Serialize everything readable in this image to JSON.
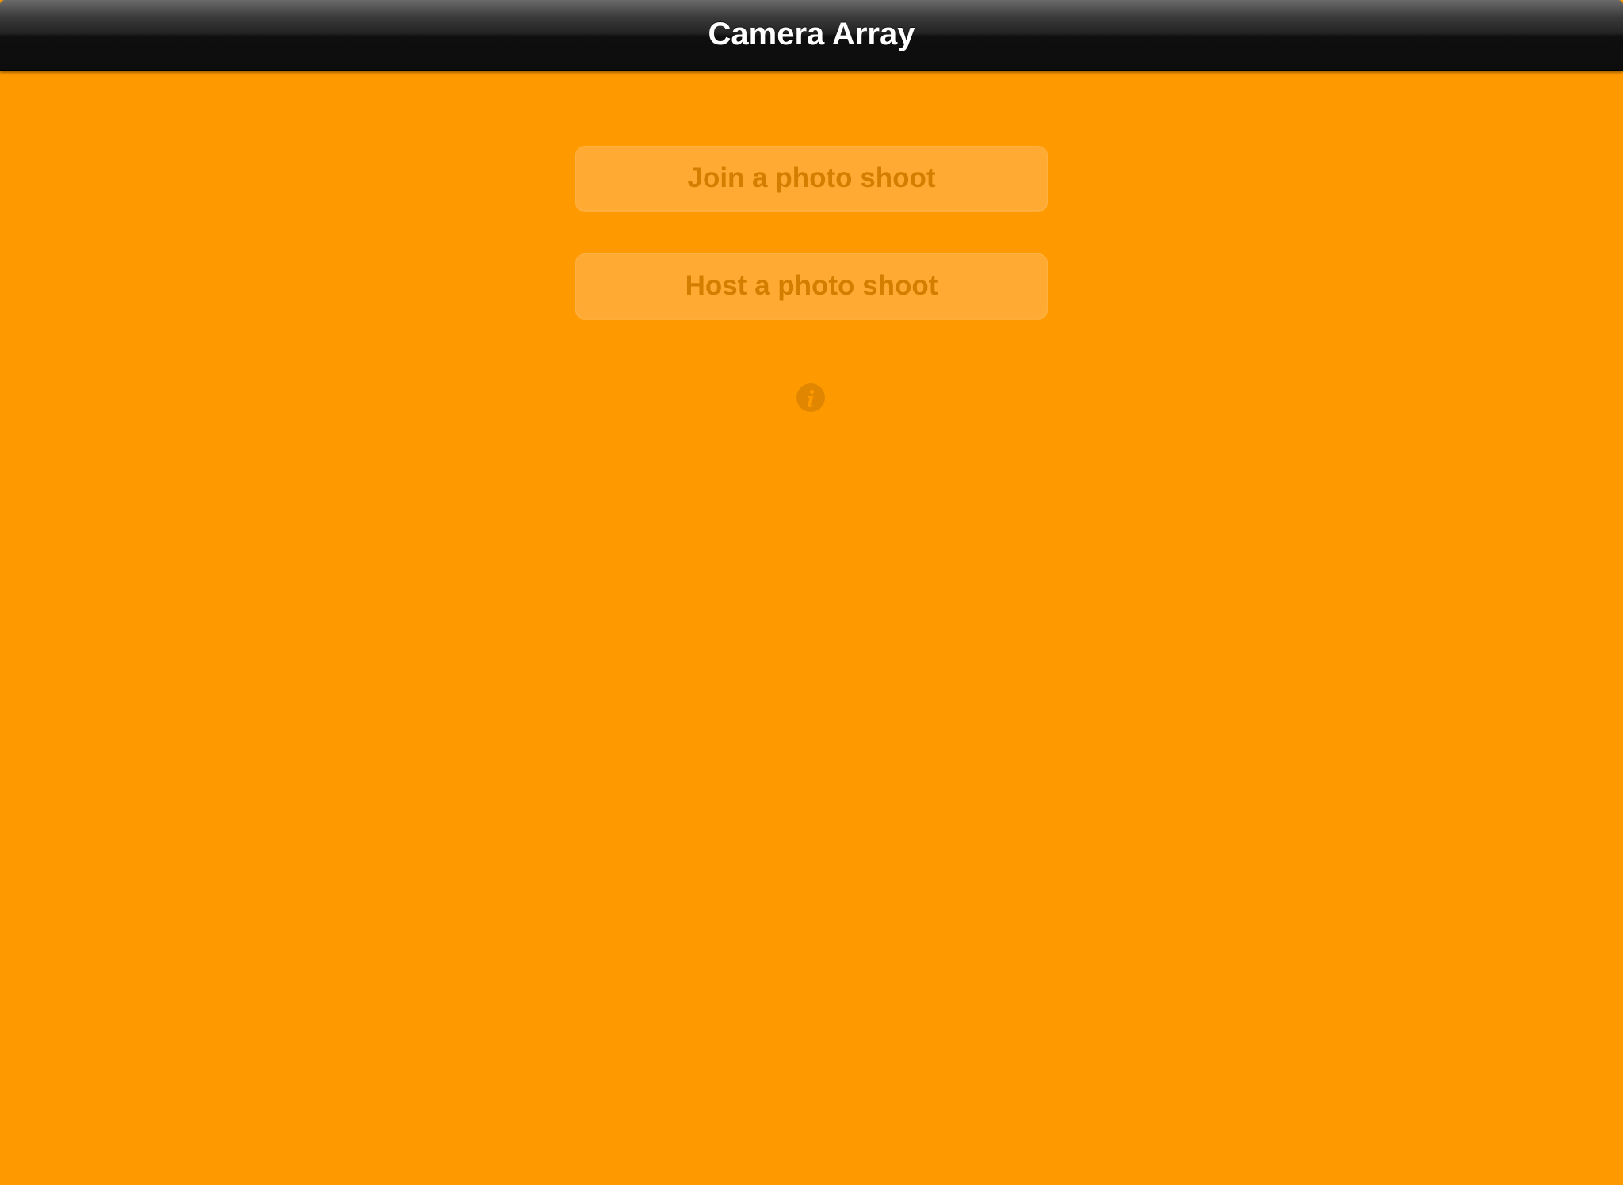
{
  "navbar": {
    "title": "Camera Array"
  },
  "menu": {
    "join_label": "Join a photo shoot",
    "host_label": "Host a photo shoot",
    "info_icon": "info-icon"
  },
  "colors": {
    "background": "#ff9900",
    "navbar": "#0d0d0d",
    "button_fill": "#ffab33",
    "button_text": "#d47e00",
    "info_icon": "#e08600"
  }
}
